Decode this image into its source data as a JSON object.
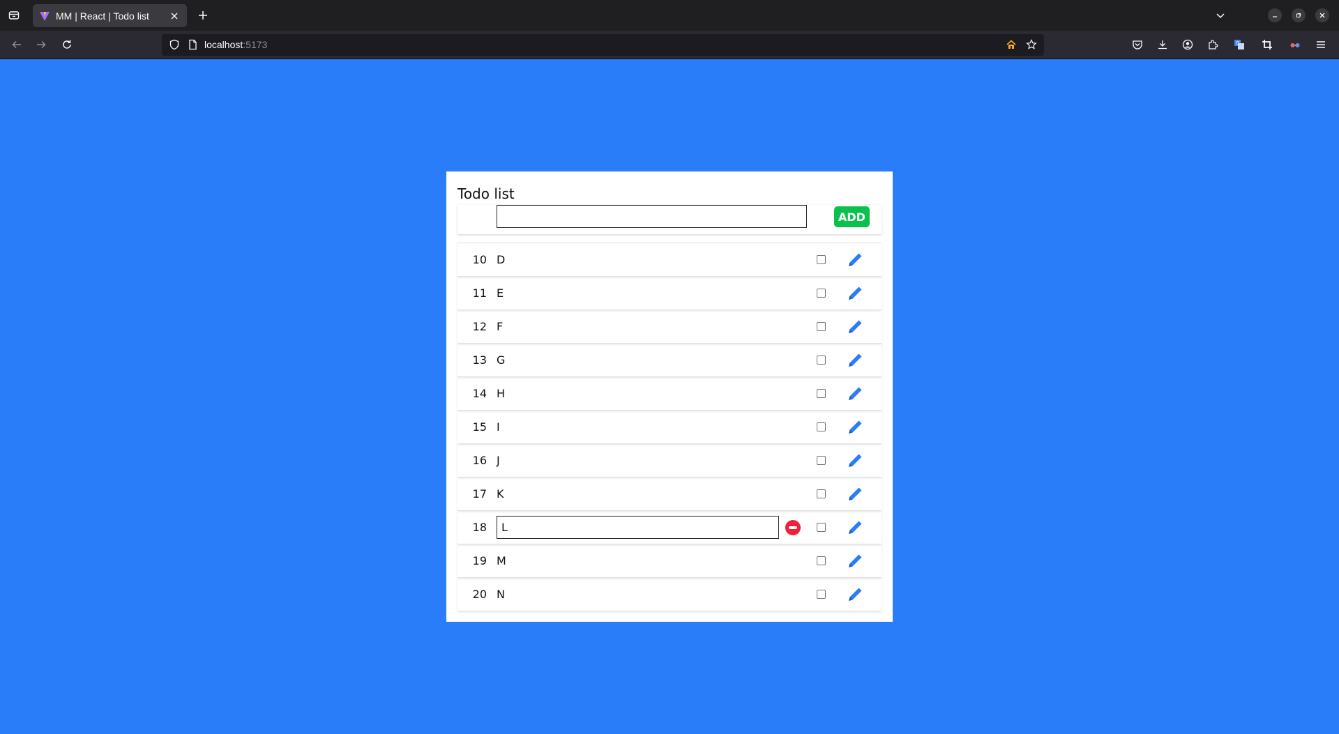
{
  "browser": {
    "tab_title": "MM | React | Todo list",
    "url_host": "localhost",
    "url_port": ":5173"
  },
  "app": {
    "title": "Todo list",
    "new_todo_value": "",
    "add_label": "ADD",
    "accent_color": "#2a7df9",
    "add_color": "#0bc14e",
    "remove_color": "#f0203a",
    "todos": [
      {
        "id": "10",
        "text": "D",
        "done": false,
        "editing": false
      },
      {
        "id": "11",
        "text": "E",
        "done": false,
        "editing": false
      },
      {
        "id": "12",
        "text": "F",
        "done": false,
        "editing": false
      },
      {
        "id": "13",
        "text": "G",
        "done": false,
        "editing": false
      },
      {
        "id": "14",
        "text": "H",
        "done": false,
        "editing": false
      },
      {
        "id": "15",
        "text": "I",
        "done": false,
        "editing": false
      },
      {
        "id": "16",
        "text": "J",
        "done": false,
        "editing": false
      },
      {
        "id": "17",
        "text": "K",
        "done": false,
        "editing": false
      },
      {
        "id": "18",
        "text": "L",
        "done": false,
        "editing": true
      },
      {
        "id": "19",
        "text": "M",
        "done": false,
        "editing": false
      },
      {
        "id": "20",
        "text": "N",
        "done": false,
        "editing": false
      }
    ]
  }
}
